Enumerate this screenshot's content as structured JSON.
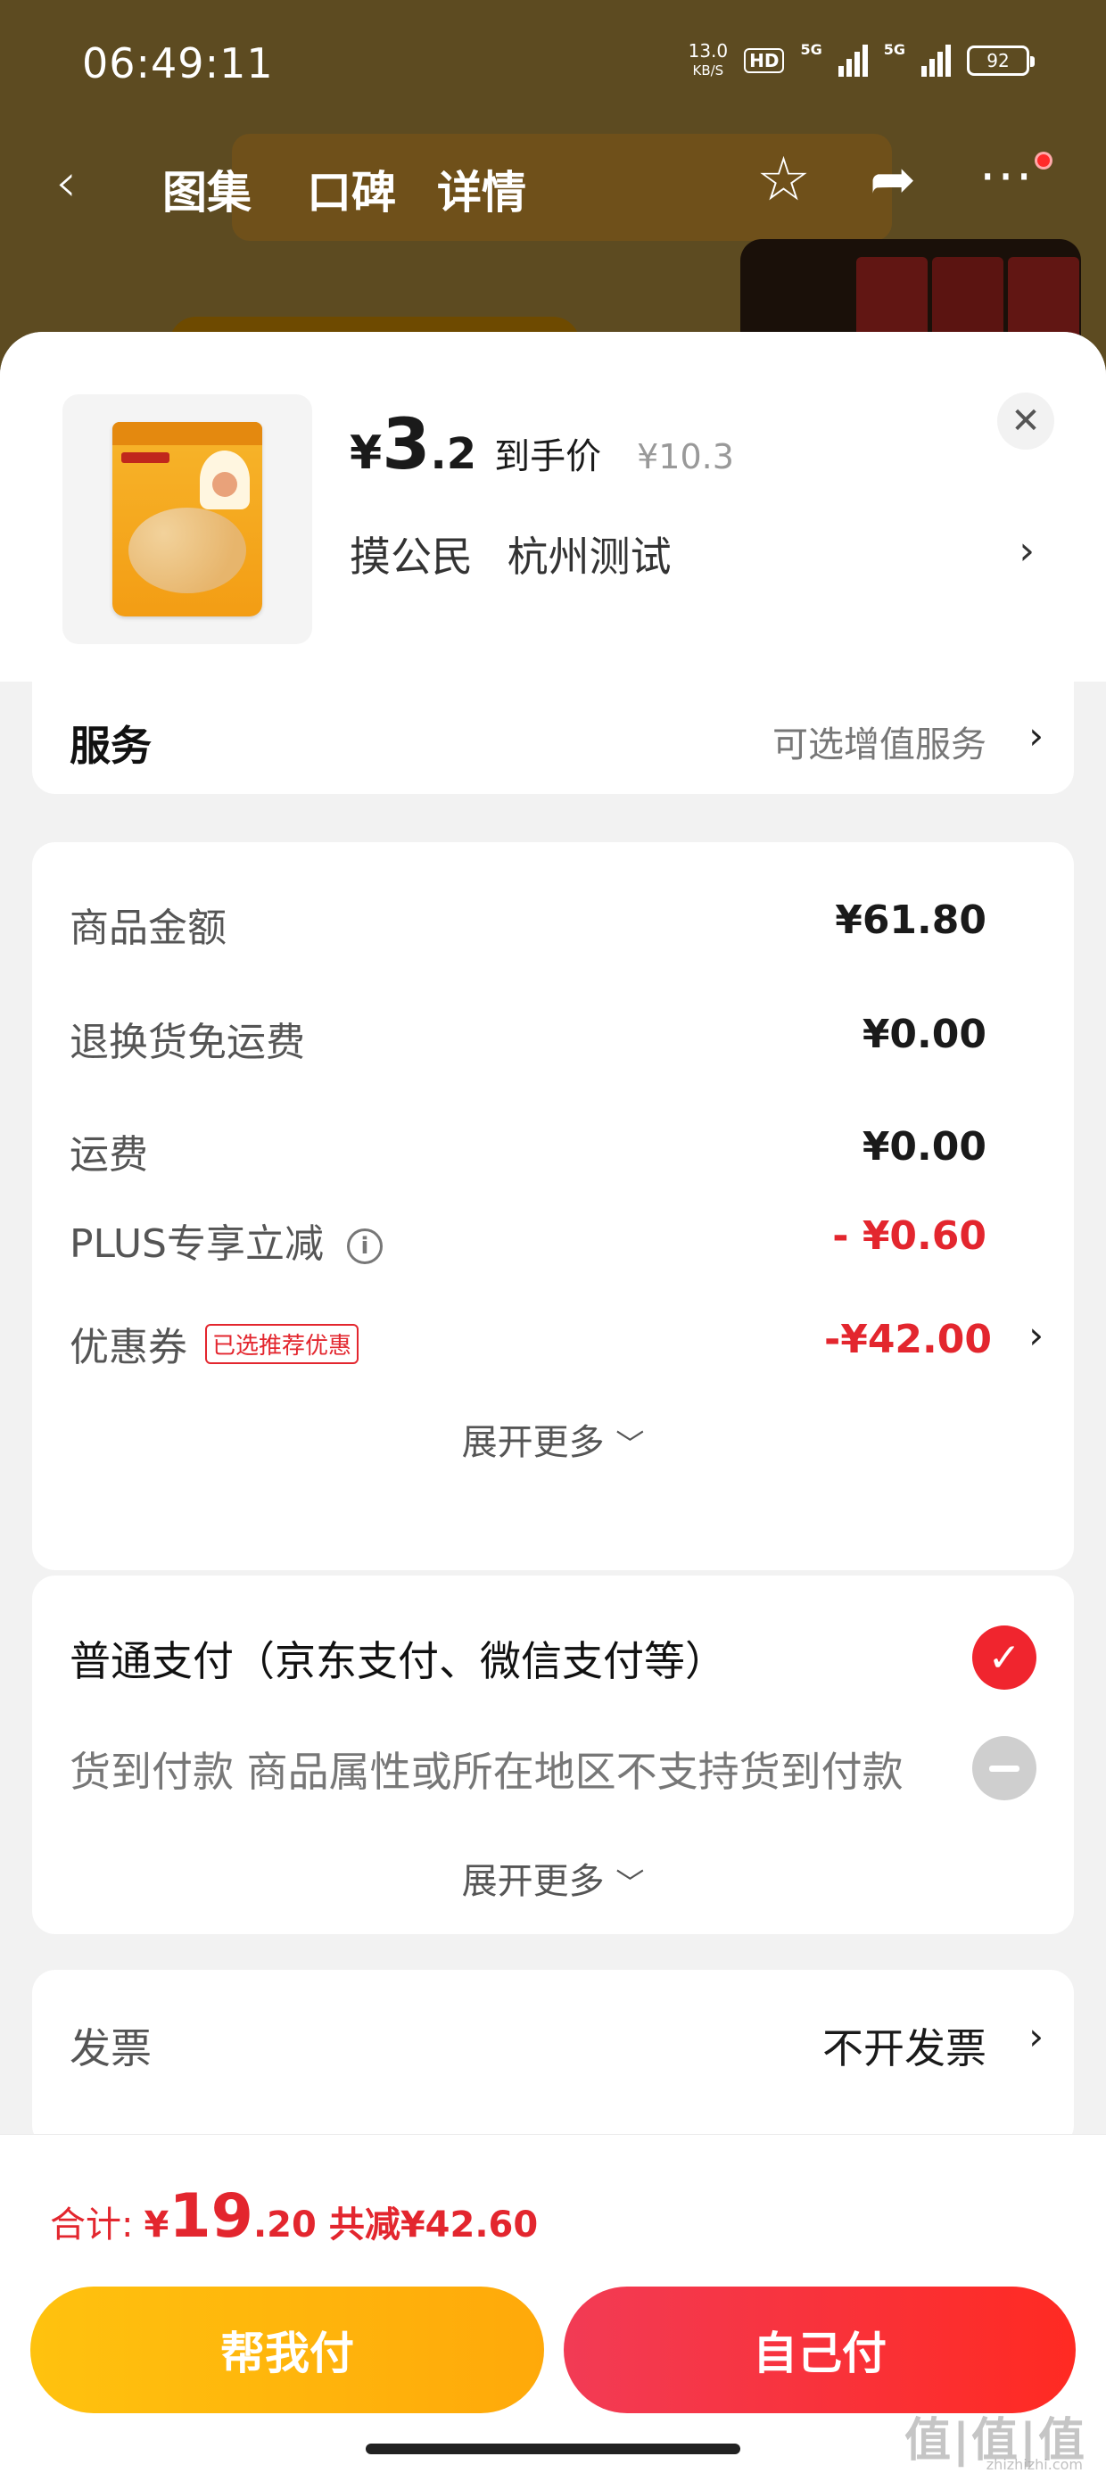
{
  "status_bar": {
    "time": "06:49:11",
    "net_speed": "13.0",
    "net_unit": "KB/S",
    "hd": "HD",
    "sig1_tag": "5G",
    "sig2_tag": "5G",
    "battery": "92"
  },
  "nav": {
    "tabs": [
      "图集",
      "口碑",
      "详情"
    ]
  },
  "product": {
    "price_yen": "¥",
    "price_int": "3",
    "price_dec": ".2",
    "price_tag": "到手价",
    "original_price": "¥10.3",
    "address_name": "摸公民",
    "address_city": "杭州测试"
  },
  "service": {
    "title": "服务",
    "value": "可选增值服务"
  },
  "amounts": {
    "rows": [
      {
        "label": "商品金额",
        "value": "¥61.80"
      },
      {
        "label": "退换货免运费",
        "value": "¥0.00"
      },
      {
        "label": "运费",
        "value": "¥0.00"
      },
      {
        "label": "PLUS专享立减",
        "value": "- ¥0.60"
      },
      {
        "label": "优惠券",
        "tag": "已选推荐优惠",
        "value": "-¥42.00"
      }
    ],
    "expand_label": "展开更多"
  },
  "payment": {
    "options": [
      {
        "label": "普通支付（京东支付、微信支付等）",
        "selected": true
      },
      {
        "label": "货到付款 商品属性或所在地区不支持货到付款",
        "selected": false
      }
    ],
    "expand_label": "展开更多"
  },
  "invoice": {
    "label": "发票",
    "value": "不开发票"
  },
  "footer": {
    "total_label": "合计:",
    "total_yen": "¥",
    "total_int": "19",
    "total_dec": ".20",
    "saved": "共减¥42.60",
    "help_pay": "帮我付",
    "self_pay": "自己付"
  },
  "watermark": {
    "text": "值|值|值",
    "site": "zhizhizhi.com"
  },
  "colors": {
    "accent_red": "#e3262e",
    "help_button": "#ffb40c",
    "self_button": "#f5323e"
  }
}
